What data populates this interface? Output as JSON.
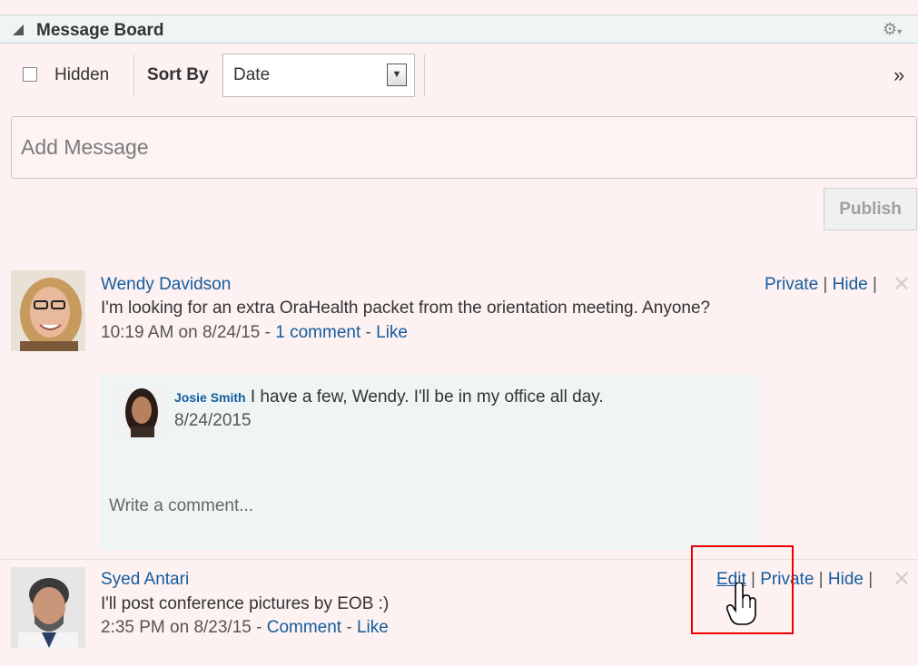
{
  "header": {
    "title": "Message Board"
  },
  "toolbar": {
    "hidden_label": "Hidden",
    "sort_by_label": "Sort By",
    "sort_value": "Date"
  },
  "composer": {
    "placeholder": "Add Message",
    "publish_label": "Publish"
  },
  "posts": [
    {
      "author": "Wendy Davidson",
      "text": "I'm looking for an extra OraHealth packet from the orientation meeting. Anyone?",
      "time": "10:19 AM on 8/24/15",
      "sep1": " - ",
      "comment_link": "1 comment",
      "sep2": " - ",
      "like_link": "Like",
      "actions": {
        "private": "Private",
        "hide": "Hide",
        "bar": " | "
      },
      "comments": [
        {
          "author": "Josie Smith",
          "text": "I have a few, Wendy. I'll be in my office all day.",
          "date": "8/24/2015"
        }
      ],
      "comment_placeholder": "Write a comment..."
    },
    {
      "author": "Syed Antari",
      "text": "I'll post conference pictures by EOB :)",
      "time": "2:35 PM on 8/23/15",
      "sep1": " - ",
      "comment_link": "Comment",
      "sep2": " - ",
      "like_link": "Like",
      "actions": {
        "edit": "Edit",
        "private": "Private",
        "hide": "Hide",
        "bar": " | "
      }
    }
  ],
  "colors": {
    "background": "#fdf1f1",
    "link": "#145c9e",
    "header_bg": "#eef5f4",
    "comment_bg": "#eef5f4",
    "highlight": "#ee0000"
  },
  "icons": [
    "collapse-triangle-icon",
    "gear-icon",
    "overflow-chevrons-icon",
    "close-icon",
    "hand-cursor-icon"
  ]
}
